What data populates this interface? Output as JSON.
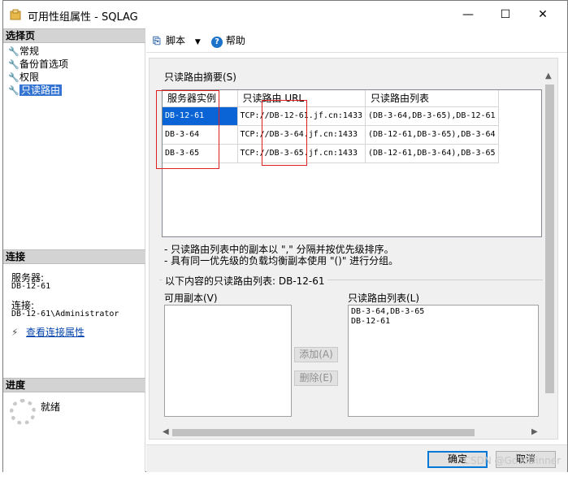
{
  "window": {
    "title": "可用性组属性 - SQLAG",
    "minimize_glyph": "—",
    "maximize_glyph": "☐",
    "close_glyph": "✕",
    "app_icon": "folder-db-icon"
  },
  "left_panel": {
    "select_page_header": "选择页",
    "nav_items": [
      "常规",
      "备份首选项",
      "权限",
      "只读路由"
    ],
    "selected_nav": "只读路由",
    "connection_header": "连接",
    "server_label": "服务器:",
    "server_value": "DB-12-61",
    "connection_label": "连接:",
    "connection_value": "DB-12-61\\Administrator",
    "view_connection_link": "查看连接属性",
    "progress_header": "进度",
    "progress_status": "就绪"
  },
  "toolbar": {
    "script_label": "脚本",
    "help_label": "帮助"
  },
  "routing_summary": {
    "group_label": "只读路由摘要(S)",
    "columns": [
      "服务器实例",
      "只读路由 URL",
      "只读路由列表"
    ],
    "rows": [
      {
        "instance": "DB-12-61",
        "url": "TCP://DB-12-61.jf.cn:1433",
        "list": "(DB-3-64,DB-3-65),DB-12-61"
      },
      {
        "instance": "DB-3-64",
        "url": "TCP://DB-3-64.jf.cn:1433",
        "list": "(DB-12-61,DB-3-65),DB-3-64"
      },
      {
        "instance": "DB-3-65",
        "url": "TCP://DB-3-65.jf.cn:1433",
        "list": "(DB-12-61,DB-3-64),DB-3-65"
      }
    ],
    "selected_row": 0
  },
  "notes": [
    "- 只读路由列表中的副本以 \",\" 分隔并按优先级排序。",
    "- 具有同一优先级的负载均衡副本使用 \"()\" 进行分组。"
  ],
  "routing_list_editor": {
    "legend": "以下内容的只读路由列表: DB-12-61",
    "available_label": "可用副本(V)",
    "routing_list_label": "只读路由列表(L)",
    "routing_list_lines": [
      "DB-3-64,DB-3-65",
      "DB-12-61"
    ],
    "add_button": "添加(A)",
    "remove_button": "删除(E)"
  },
  "footer": {
    "ok_label": "确定",
    "cancel_label": "取消"
  },
  "watermark": "CSDN @GoToDinner",
  "colors": {
    "selection": "#0a64d6",
    "nav_selection": "#3373d1",
    "annotation_red": "#e02020",
    "default_button_border": "#0078d7"
  }
}
